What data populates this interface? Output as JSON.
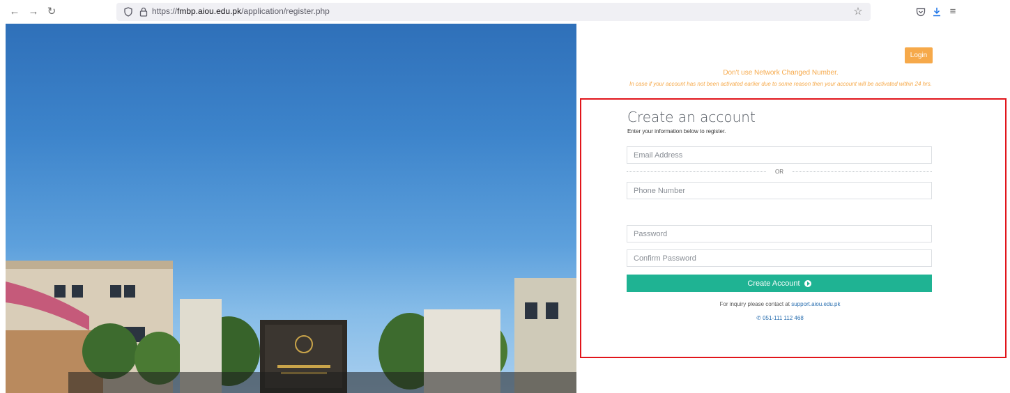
{
  "browser": {
    "url_prefix": "https://",
    "url_host": "fmbp.aiou.edu.pk",
    "url_path": "/application/register.php",
    "icons": [
      "back-icon",
      "forward-icon",
      "reload-icon",
      "shield-icon",
      "lock-icon",
      "star-icon",
      "pocket-icon",
      "download-icon",
      "menu-icon"
    ]
  },
  "header": {
    "login_label": "Login",
    "notice": "Don't use Network Changed Number.",
    "notice_sub": "In case if your account has not been activated earlier due to some reason then your account will be activated within 24 hrs."
  },
  "form": {
    "title": "Create an account",
    "subtitle": "Enter your information below to register.",
    "email_placeholder": "Email Address",
    "or_label": "OR",
    "phone_placeholder": "Phone Number",
    "password_placeholder": "Password",
    "confirm_placeholder": "Confirm Password",
    "submit_label": "Create Account"
  },
  "footer": {
    "inquiry_text": "For inquiry please contact at",
    "inquiry_link": "support.aiou.edu.pk",
    "phone": "051-111 112 468"
  },
  "colors": {
    "accent_orange": "#f6a94a",
    "accent_green": "#1fb393",
    "highlight_red": "#e1151b",
    "link_blue": "#2a6fb0"
  }
}
